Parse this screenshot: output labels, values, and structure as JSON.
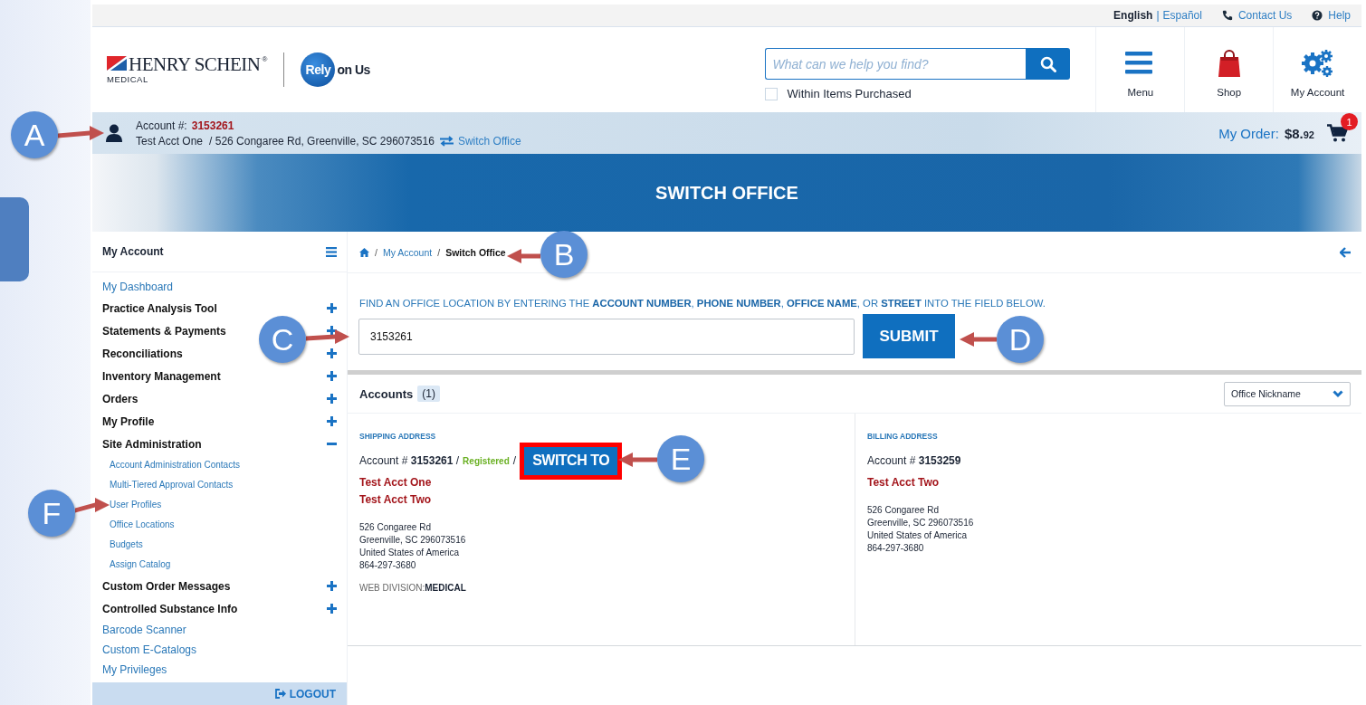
{
  "utility_bar": {
    "separator": "|",
    "languages": [
      {
        "label": "English",
        "selected": true
      },
      {
        "label": "Español",
        "selected": false
      }
    ],
    "links": [
      {
        "label": "Contact Us"
      },
      {
        "label": "Help"
      }
    ]
  },
  "logo": {
    "brand": "HENRY SCHEIN",
    "registered": "®",
    "division": "MEDICAL",
    "badge": "Rely",
    "tagline": "on Us"
  },
  "search": {
    "placeholder": "What can we help you find?",
    "filter": {
      "label": "Within Items Purchased",
      "checked": false
    }
  },
  "nav": [
    {
      "label": "Menu"
    },
    {
      "label": "Shop"
    },
    {
      "label": "My Account"
    }
  ],
  "account_bar": {
    "label": "Account #:",
    "number": "3153261",
    "name": "Test Acct One",
    "address": "/ 526 Congaree Rd, Greenville, SC 296073516",
    "switch_link": "Switch Office",
    "order_label": "My Order:",
    "order_dollars": "$8.",
    "order_cents": "92",
    "cart_count": "1"
  },
  "banner": {
    "title": "SWITCH OFFICE"
  },
  "sidebar": {
    "title": "My Account",
    "items": [
      {
        "kind": "link",
        "label": "My Dashboard"
      },
      {
        "kind": "section",
        "label": "Practice Analysis Tool",
        "expanded": false
      },
      {
        "kind": "section",
        "label": "Statements & Payments",
        "expanded": false
      },
      {
        "kind": "section",
        "label": "Reconciliations",
        "expanded": false
      },
      {
        "kind": "section",
        "label": "Inventory Management",
        "expanded": false
      },
      {
        "kind": "section",
        "label": "Orders",
        "expanded": false
      },
      {
        "kind": "section",
        "label": "My Profile",
        "expanded": false
      },
      {
        "kind": "section",
        "label": "Site Administration",
        "expanded": true,
        "children": [
          {
            "label": "Account Administration Contacts"
          },
          {
            "label": "Multi-Tiered Approval Contacts"
          },
          {
            "label": "User Profiles"
          },
          {
            "label": "Office Locations"
          },
          {
            "label": "Budgets"
          },
          {
            "label": "Assign Catalog"
          }
        ]
      },
      {
        "kind": "section",
        "label": "Custom Order Messages",
        "expanded": false
      },
      {
        "kind": "section",
        "label": "Controlled Substance Info",
        "expanded": false
      },
      {
        "kind": "link",
        "label": "Barcode Scanner"
      },
      {
        "kind": "link",
        "label": "Custom E-Catalogs"
      },
      {
        "kind": "link",
        "label": "My Privileges"
      }
    ],
    "logout": "LOGOUT"
  },
  "breadcrumb_separator": "/",
  "breadcrumb": [
    {
      "label": "My Account",
      "current": false
    },
    {
      "label": "Switch Office",
      "current": true
    }
  ],
  "instructions": "FIND AN OFFICE LOCATION BY ENTERING THE **ACCOUNT NUMBER**, **PHONE NUMBER**, **OFFICE NAME**, OR **STREET** INTO THE FIELD BELOW.",
  "office_search": {
    "value": "3153261",
    "submit": "SUBMIT"
  },
  "accounts": {
    "title": "Accounts",
    "count": "(1)",
    "sort": "Office Nickname",
    "shipping": {
      "heading": "SHIPPING ADDRESS",
      "account": "Account # **3153261** /",
      "status": "Registered",
      "separator": "/",
      "button": "SWITCH TO",
      "highlighted": true,
      "names": [
        "Test Acct One",
        "Test Acct Two"
      ],
      "address": [
        "526 Congaree Rd",
        "Greenville, SC 296073516",
        "United States of America",
        "864-297-3680"
      ],
      "division_label": "WEB DIVISION:",
      "division": "MEDICAL"
    },
    "billing": {
      "heading": "BILLING ADDRESS",
      "account": "Account # **3153259**",
      "names": [
        "Test Acct Two"
      ],
      "address": [
        "526 Congaree Rd",
        "Greenville, SC 296073516",
        "United States of America",
        "864-297-3680"
      ]
    }
  },
  "callouts": [
    {
      "letter": "A"
    },
    {
      "letter": "B"
    },
    {
      "letter": "C"
    },
    {
      "letter": "D"
    },
    {
      "letter": "E"
    },
    {
      "letter": "F"
    }
  ]
}
